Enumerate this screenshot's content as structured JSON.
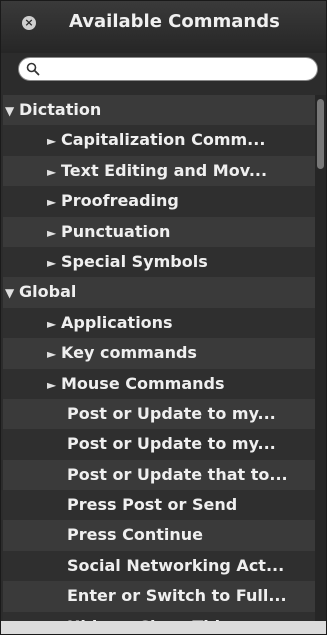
{
  "window": {
    "title": "Available Commands",
    "close_glyph": "×"
  },
  "search": {
    "value": "",
    "placeholder": ""
  },
  "list": {
    "items": [
      {
        "label": "Dictation",
        "level": 0,
        "expander": "▼"
      },
      {
        "label": "Capitalization Comm...",
        "level": 1,
        "expander": "►"
      },
      {
        "label": "Text Editing and Mov...",
        "level": 1,
        "expander": "►"
      },
      {
        "label": "Proofreading",
        "level": 1,
        "expander": "►"
      },
      {
        "label": "Punctuation",
        "level": 1,
        "expander": "►"
      },
      {
        "label": "Special Symbols",
        "level": 1,
        "expander": "►"
      },
      {
        "label": "Global",
        "level": 0,
        "expander": "▼"
      },
      {
        "label": "Applications",
        "level": 1,
        "expander": "►"
      },
      {
        "label": "Key commands",
        "level": 1,
        "expander": "►"
      },
      {
        "label": "Mouse Commands",
        "level": 1,
        "expander": "►"
      },
      {
        "label": "Post or Update to my...",
        "level": 2,
        "expander": ""
      },
      {
        "label": "Post or Update to my...",
        "level": 2,
        "expander": ""
      },
      {
        "label": "Post or Update that to...",
        "level": 2,
        "expander": ""
      },
      {
        "label": "Press Post or Send",
        "level": 2,
        "expander": ""
      },
      {
        "label": "Press Continue",
        "level": 2,
        "expander": ""
      },
      {
        "label": "Social Networking Act...",
        "level": 2,
        "expander": ""
      },
      {
        "label": "Enter or Switch to Full...",
        "level": 2,
        "expander": ""
      },
      {
        "label": "Hide or Close This or...",
        "level": 2,
        "expander": ""
      }
    ]
  },
  "colors": {
    "panel_bg": "#2c2c2c",
    "row_odd": "#3a3a3a",
    "row_even": "#2f2f2f",
    "text": "#efefef"
  }
}
